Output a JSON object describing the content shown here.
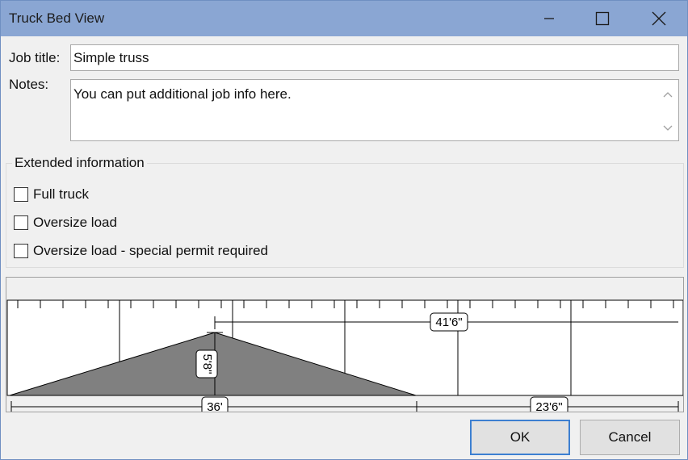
{
  "window": {
    "title": "Truck Bed View"
  },
  "form": {
    "job_title_label": "Job title:",
    "job_title_value": "Simple truss",
    "notes_label": "Notes:",
    "notes_value": "You can put additional job info here."
  },
  "extended": {
    "title": "Extended information",
    "full_truck_label": "Full truck",
    "full_truck_checked": false,
    "oversize_label": "Oversize load",
    "oversize_checked": false,
    "oversize_permit_label": "Oversize load - special permit required",
    "oversize_permit_checked": false
  },
  "bed_view": {
    "height_dim": "5'8\"",
    "length_dim": "41'6\"",
    "load_length_dim": "36'",
    "remaining_dim": "23'6\""
  },
  "buttons": {
    "ok": "OK",
    "cancel": "Cancel"
  },
  "colors": {
    "titlebar": "#8aa6d3",
    "load_fill": "#808080",
    "ok_border": "#3c7fd1"
  }
}
